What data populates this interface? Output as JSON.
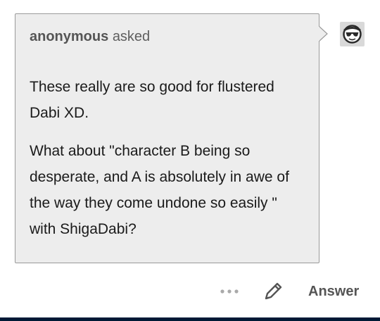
{
  "ask": {
    "asker_name": "anonymous",
    "asker_verb": "asked",
    "paragraphs": [
      "These really are so good for flustered Dabi XD.",
      "What about \"character B being so desperate, and A is absolutely in awe of the way they come undone so easily \" with ShigaDabi?"
    ]
  },
  "recipient": {
    "avatar_icon": "sunglasses-face-icon"
  },
  "actions": {
    "more_icon": "more-dots-icon",
    "edit_icon": "pencil-icon",
    "answer_label": "Answer"
  },
  "colors": {
    "bubble_bg": "#ededed",
    "bubble_border": "#9a9a9a",
    "text": "#1a1a1a",
    "muted": "#5e5e5e",
    "footer_bar": "#001935"
  }
}
